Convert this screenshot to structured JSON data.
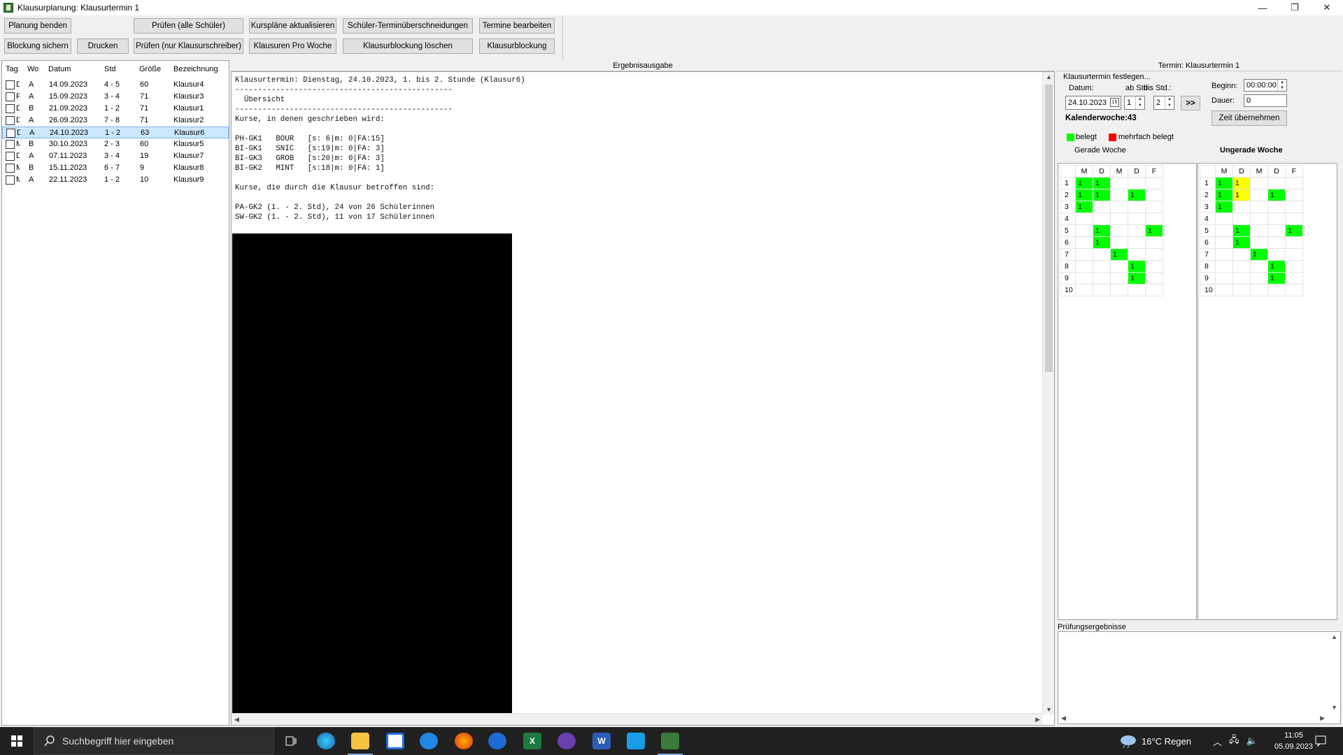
{
  "window": {
    "title": "Klausurplanung: Klausurtermin 1",
    "minimize": "—",
    "restore": "❐",
    "close": "✕"
  },
  "toolbar": {
    "planung_beenden": "Planung benden",
    "blockung_sichern": "Blockung sichern",
    "drucken": "Drucken",
    "pruefen_alle": "Prüfen (alle Schüler)",
    "pruefen_klausurschreiber": "Prüfen (nur Klausurschreiber)",
    "kursplaene_aktualisieren": "Kurspläne aktualisieren",
    "klausuren_pro_woche": "Klausuren Pro Woche",
    "schueler_terminueberschneidungen": "Schüler-Terminüberschneidungen",
    "klausurblockung_loeschen": "Klausurblockung löschen",
    "termine_bearbeiten": "Termine bearbeiten",
    "klausurblockung": "Klausurblockung"
  },
  "list": {
    "headers": {
      "tag": "Tag",
      "wo": "Wo",
      "datum": "Datum",
      "std": "Std",
      "groesse": "Größe",
      "bezeichnung": "Bezeichnung"
    },
    "rows": [
      {
        "tag": "D",
        "wo": "A",
        "datum": "14.09.2023",
        "std": "4 - 5",
        "groesse": "60",
        "bezeichnung": "Klausur4"
      },
      {
        "tag": "F",
        "wo": "A",
        "datum": "15.09.2023",
        "std": "3 - 4",
        "groesse": "71",
        "bezeichnung": "Klausur3"
      },
      {
        "tag": "D",
        "wo": "B",
        "datum": "21.09.2023",
        "std": "1 - 2",
        "groesse": "71",
        "bezeichnung": "Klausur1"
      },
      {
        "tag": "D",
        "wo": "A",
        "datum": "26.09.2023",
        "std": "7 - 8",
        "groesse": "71",
        "bezeichnung": "Klausur2"
      },
      {
        "tag": "D",
        "wo": "A",
        "datum": "24.10.2023",
        "std": "1 - 2",
        "groesse": "63",
        "bezeichnung": "Klausur6"
      },
      {
        "tag": "M",
        "wo": "B",
        "datum": "30.10.2023",
        "std": "2 - 3",
        "groesse": "60",
        "bezeichnung": "Klausur5"
      },
      {
        "tag": "D",
        "wo": "A",
        "datum": "07.11.2023",
        "std": "3 - 4",
        "groesse": "19",
        "bezeichnung": "Klausur7"
      },
      {
        "tag": "M",
        "wo": "B",
        "datum": "15.11.2023",
        "std": "6 - 7",
        "groesse": "9",
        "bezeichnung": "Klausur8"
      },
      {
        "tag": "M",
        "wo": "A",
        "datum": "22.11.2023",
        "std": "1 - 2",
        "groesse": "10",
        "bezeichnung": "Klausur9"
      }
    ]
  },
  "output": {
    "header": "Ergebnisausgabe",
    "text": "Klausurtermin: Dienstag, 24.10.2023, 1. bis 2. Stunde (Klausur6)\n------------------------------------------------\n  Übersicht\n------------------------------------------------\nKurse, in denen geschrieben wird:\n\nPH-GK1   BOUR   [s: 6|m: 0|FA:15]\nBI-GK1   SNIC   [s:19|m: 0|FA: 3]\nBI-GK3   GROB   [s:20|m: 0|FA: 3]\nBI-GK2   MINT   [s:18|m: 0|FA: 1]\n\nKurse, die durch die Klausur betroffen sind:\n\nPA-GK2 (1. - 2. Std), 24 von 26 Schülerinnen\nSW-GK2 (1. - 2. Std), 11 von 17 Schülerinnen"
  },
  "termin": {
    "header": "Termin: Klausurtermin 1",
    "festlegen": "Klausurtermin festlegen...",
    "datum_label": "Datum:",
    "ab_std_label": "ab Std.:",
    "bis_std_label": "bis Std.:",
    "datum_value": "24.10.2023",
    "ab_std_value": "1",
    "bis_std_value": "2",
    "arrow_button": ">>",
    "beginn_label": "Beginn:",
    "beginn_value": "00:00:00",
    "dauer_label": "Dauer:",
    "dauer_value": "0",
    "zeit_uebernehmen": "Zeit übernehmen",
    "kalenderwoche": "Kalenderwoche:43",
    "legend_belegt": "belegt",
    "legend_mehrfach": "mehrfach belegt",
    "gerade_woche": "Gerade Woche",
    "ungerade_woche": "Ungerade Woche",
    "days": [
      "M",
      "D",
      "M",
      "D",
      "F"
    ],
    "colors": {
      "belegt": "#00ff00",
      "mehrfach": "#ff0000",
      "partial": "#ffff00"
    },
    "gerade_grid": [
      [
        "g1",
        "g1",
        "",
        "",
        ""
      ],
      [
        "g1",
        "g1",
        "",
        "g1",
        ""
      ],
      [
        "g1",
        "",
        "",
        "",
        ""
      ],
      [
        "",
        "",
        "",
        "",
        ""
      ],
      [
        "",
        "g1",
        "",
        "",
        "g1"
      ],
      [
        "",
        "g1",
        "",
        "",
        ""
      ],
      [
        "",
        "",
        "g1",
        "",
        ""
      ],
      [
        "",
        "",
        "",
        "g1",
        ""
      ],
      [
        "",
        "",
        "",
        "g1",
        ""
      ],
      [
        "",
        "",
        "",
        "",
        ""
      ]
    ],
    "ungerade_grid": [
      [
        "g1",
        "y1",
        "",
        "",
        ""
      ],
      [
        "g1",
        "y1",
        "",
        "g1",
        ""
      ],
      [
        "g1",
        "",
        "",
        "",
        ""
      ],
      [
        "",
        "",
        "",
        "",
        ""
      ],
      [
        "",
        "g1",
        "",
        "",
        "g1"
      ],
      [
        "",
        "g1",
        "",
        "",
        ""
      ],
      [
        "",
        "",
        "g1",
        "",
        ""
      ],
      [
        "",
        "",
        "",
        "g1",
        ""
      ],
      [
        "",
        "",
        "",
        "g1",
        ""
      ],
      [
        "",
        "",
        "",
        "",
        ""
      ]
    ]
  },
  "pruefungsergebnisse": {
    "label": "Prüfungsergebnisse"
  },
  "taskbar": {
    "search_placeholder": "Suchbegriff hier eingeben",
    "weather": "16°C  Regen",
    "time": "11:05",
    "date": "05.09.2023"
  }
}
